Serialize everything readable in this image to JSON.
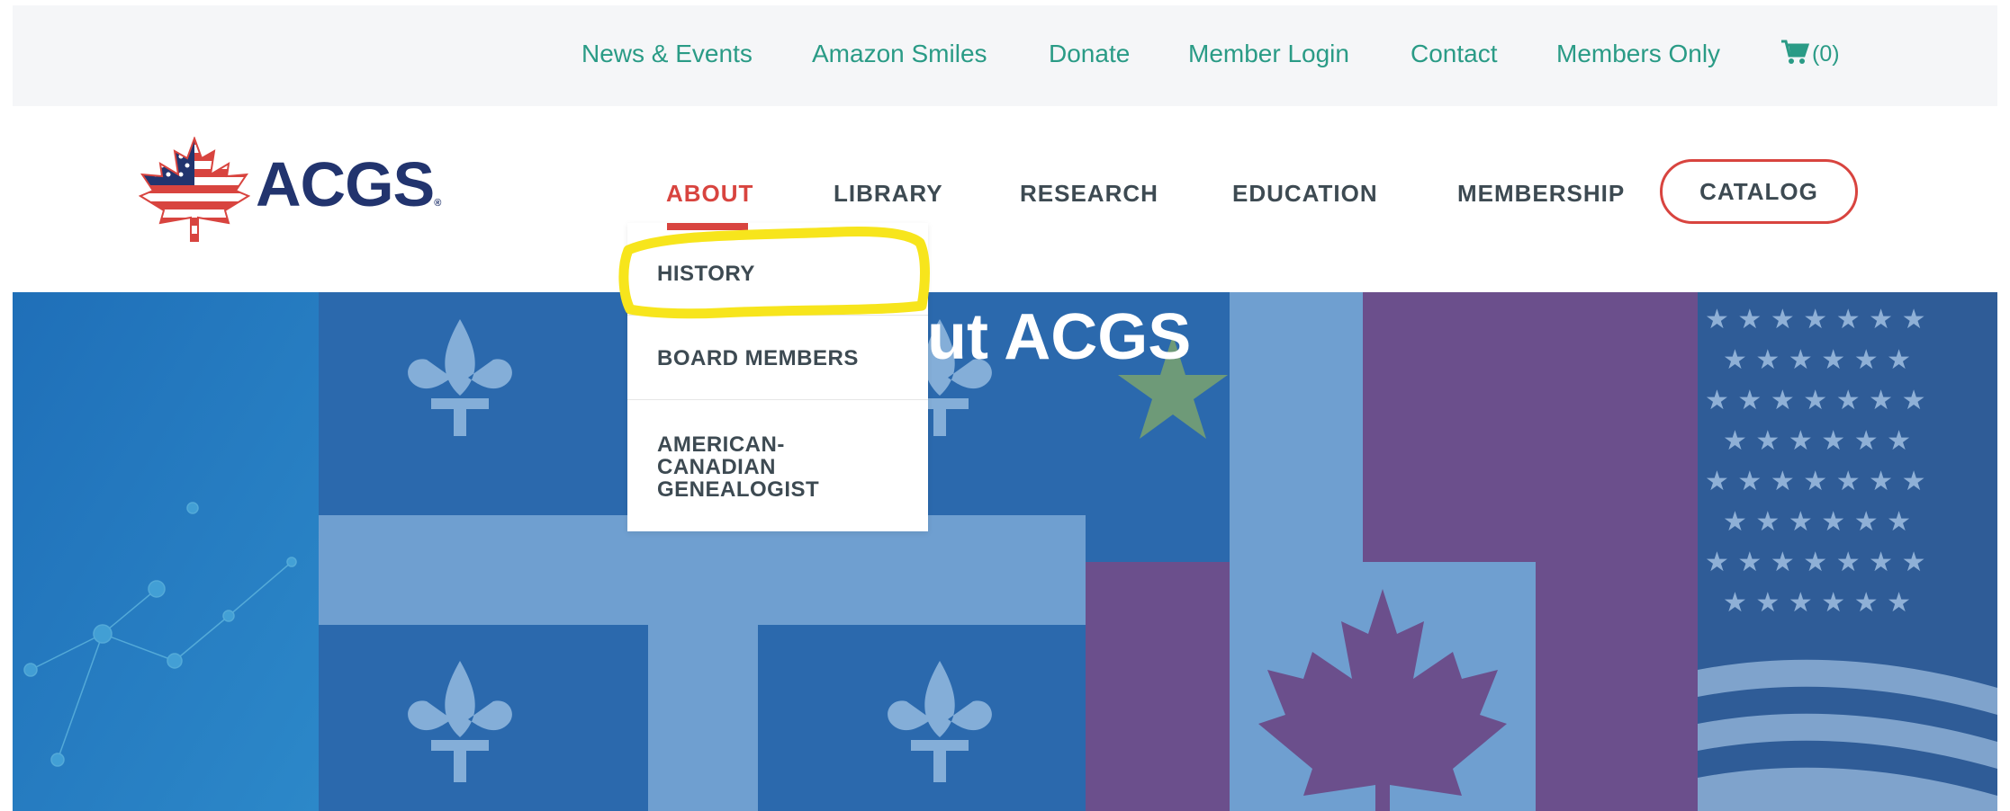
{
  "utility_nav": {
    "items": [
      "News & Events",
      "Amazon Smiles",
      "Donate",
      "Member Login",
      "Contact",
      "Members Only"
    ],
    "cart_count": "(0)"
  },
  "logo": {
    "text": "ACGS",
    "registered": "®"
  },
  "main_nav": {
    "items": [
      "ABOUT",
      "LIBRARY",
      "RESEARCH",
      "EDUCATION",
      "MEMBERSHIP"
    ],
    "active": "ABOUT",
    "catalog_label": "CATALOG"
  },
  "dropdown": {
    "items": [
      "HISTORY",
      "BOARD MEMBERS",
      "AMERICAN-\nCANADIAN\nGENEALOGIST"
    ]
  },
  "hero": {
    "title": "About ACGS",
    "visible_title": "ut ACGS"
  },
  "colors": {
    "accent_green": "#2a9b86",
    "accent_red": "#d8443f",
    "navy": "#22346e",
    "nav_text": "#3d4a52",
    "highlight_yellow": "#f7e51c"
  }
}
